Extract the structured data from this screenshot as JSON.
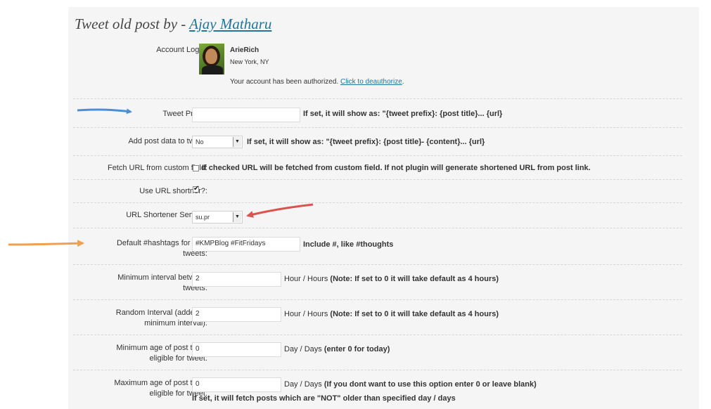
{
  "header": {
    "title_prefix": "Tweet old post by - ",
    "title_link": "Ajay Matharu"
  },
  "account": {
    "label": "Account Login:",
    "username": "ArieRich",
    "location": "New York, NY",
    "status_text": "Your account has been authorized. ",
    "deauth_link": "Click to deauthorize",
    "status_end": "."
  },
  "fields": {
    "tweet_prefix": {
      "label": "Tweet Prefix:",
      "value": "",
      "hint": "If set, it will show as: \"{tweet prefix}: {post title}... {url}"
    },
    "add_post_data": {
      "label": "Add post data to tweet:",
      "value": "No",
      "hint": "If set, it will show as: \"{tweet prefix}: {post title}- {content}... {url}"
    },
    "fetch_url": {
      "label": "Fetch URL from custom field:",
      "checked": false,
      "hint": "If checked URL will be fetched from custom field. If not plugin will generate shortened URL from post link."
    },
    "use_shortener": {
      "label": "Use URL shortner?:",
      "checked": true
    },
    "shortener_service": {
      "label": "URL Shortener Service:",
      "value": "su.pr"
    },
    "hashtags": {
      "label_1": "Default #hashtags for your",
      "label_2": "tweets:",
      "value": "#KMPBlog #FitFridays",
      "hint": "Include #, like #thoughts"
    },
    "min_interval": {
      "label_1": "Minimum interval between",
      "label_2": "tweets:",
      "value": "2",
      "unit": "Hour / Hours ",
      "hint": "(Note: If set to 0 it will take default as 4 hours)"
    },
    "random_interval": {
      "label_1": "Random Interval (added to",
      "label_2": "minimum interval):",
      "value": "2",
      "unit": "Hour / Hours ",
      "hint": "(Note: If set to 0 it will take default as 4 hours)"
    },
    "min_age": {
      "label_1": "Minimum age of post to be",
      "label_2": "eligible for tweet:",
      "value": "0",
      "unit": "Day / Days ",
      "hint": "(enter 0 for today)"
    },
    "max_age": {
      "label_1": "Maximum age of post to be",
      "label_2": "eligible for tweet:",
      "value": "0",
      "unit": "Day / Days ",
      "hint": "(If you dont want to use this option enter 0 or leave blank)",
      "note": "If set, it will fetch posts which are \"NOT\" older than specified day / days"
    }
  },
  "colors": {
    "arrow_blue": "#4a8fd6",
    "arrow_red": "#d9534f",
    "arrow_orange": "#f0a050",
    "link": "#21759b"
  }
}
